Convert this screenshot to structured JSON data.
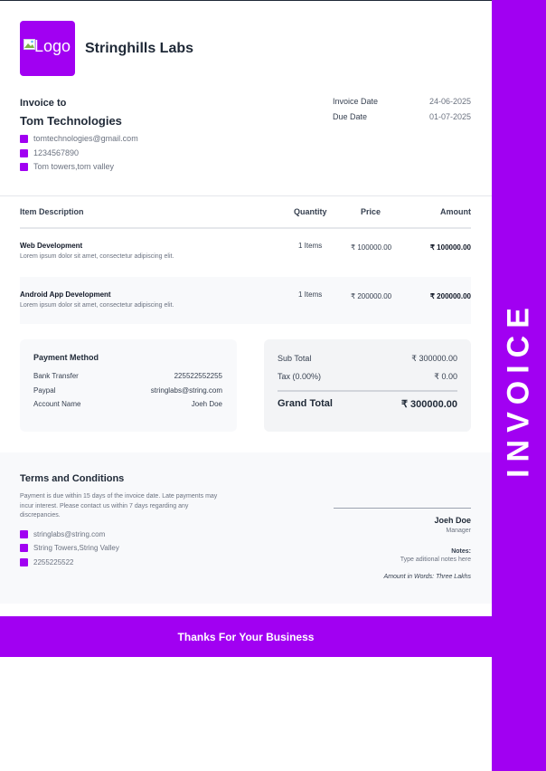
{
  "sidebar": {
    "label": "INVOICE"
  },
  "header": {
    "logo_alt": "Logo",
    "company": "Stringhills Labs"
  },
  "bill_to": {
    "heading": "Invoice to",
    "name": "Tom Technologies",
    "email": "tomtechnologies@gmail.com",
    "phone": "1234567890",
    "address": "Tom towers,tom valley"
  },
  "meta": {
    "invoice_date_label": "Invoice Date",
    "invoice_date": "24-06-2025",
    "due_date_label": "Due Date",
    "due_date": "01-07-2025"
  },
  "table": {
    "headers": {
      "description": "Item Description",
      "quantity": "Quantity",
      "price": "Price",
      "amount": "Amount"
    },
    "rows": [
      {
        "title": "Web Development",
        "desc": "Lorem ipsum dolor sit amet, consectetur adipiscing elit.",
        "qty": "1 Items",
        "price": "₹ 100000.00",
        "amount": "₹ 100000.00"
      },
      {
        "title": "Android App Development",
        "desc": "Lorem ipsum dolor sit amet, consectetur adipiscing elit.",
        "qty": "1 Items",
        "price": "₹ 200000.00",
        "amount": "₹ 200000.00"
      }
    ]
  },
  "payment": {
    "title": "Payment Method",
    "rows": [
      {
        "label": "Bank Transfer",
        "value": "225522552255"
      },
      {
        "label": "Paypal",
        "value": "stringlabs@string.com"
      },
      {
        "label": "Account Name",
        "value": "Joeh Doe"
      }
    ]
  },
  "totals": {
    "subtotal_label": "Sub Total",
    "subtotal": "₹ 300000.00",
    "tax_label": "Tax (0.00%)",
    "tax": "₹ 0.00",
    "grand_label": "Grand Total",
    "grand": "₹ 300000.00"
  },
  "terms": {
    "title": "Terms and Conditions",
    "text": "Payment is due within 15 days of the invoice date. Late payments may incur interest. Please contact us within 7 days regarding any discrepancies.",
    "email": "stringlabs@string.com",
    "address": "String Towers,String Valley",
    "phone": "2255225522"
  },
  "signature": {
    "name": "Joeh Doe",
    "role": "Manager",
    "notes_label": "Notes:",
    "notes": "Type aditional notes here",
    "amount_words": "Amount in Words: Three Lakhs"
  },
  "footer": {
    "thanks": "Thanks For Your Business"
  },
  "colors": {
    "accent": "#a100f2"
  }
}
